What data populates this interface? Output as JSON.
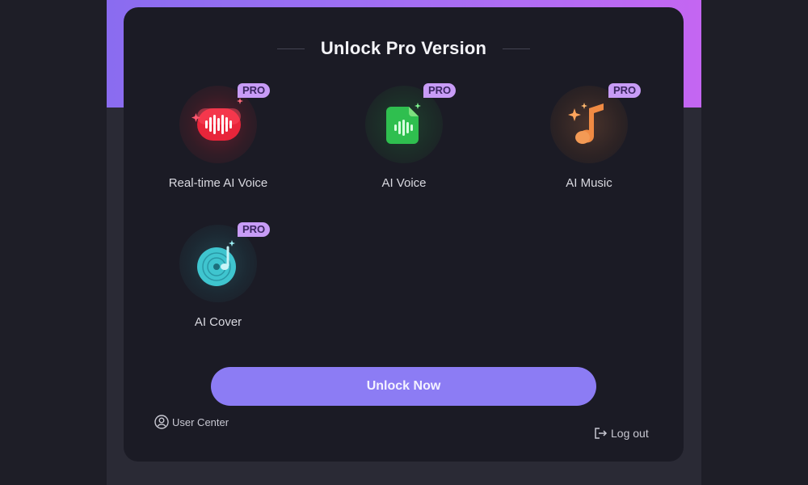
{
  "title": "Unlock Pro Version",
  "badge": "PRO",
  "features": [
    {
      "label": "Real-time AI Voice",
      "icon": "red-voice-wave-icon",
      "color": "#e8253a"
    },
    {
      "label": "AI Voice",
      "icon": "green-voice-file-icon",
      "color": "#2fbf4f"
    },
    {
      "label": "AI Music",
      "icon": "orange-music-note-icon",
      "color": "#f08a43"
    },
    {
      "label": "AI Cover",
      "icon": "teal-vinyl-record-icon",
      "color": "#3fc5cf"
    }
  ],
  "unlock_button": "Unlock Now",
  "user_center": "User Center",
  "logout": "Log out",
  "colors": {
    "background": "#1e1e27",
    "panel": "#1b1b25",
    "accent_button": "#8c7cf4",
    "gradient_start": "#8a6cf0",
    "gradient_end": "#c466f2",
    "badge": "#c89cf6"
  }
}
